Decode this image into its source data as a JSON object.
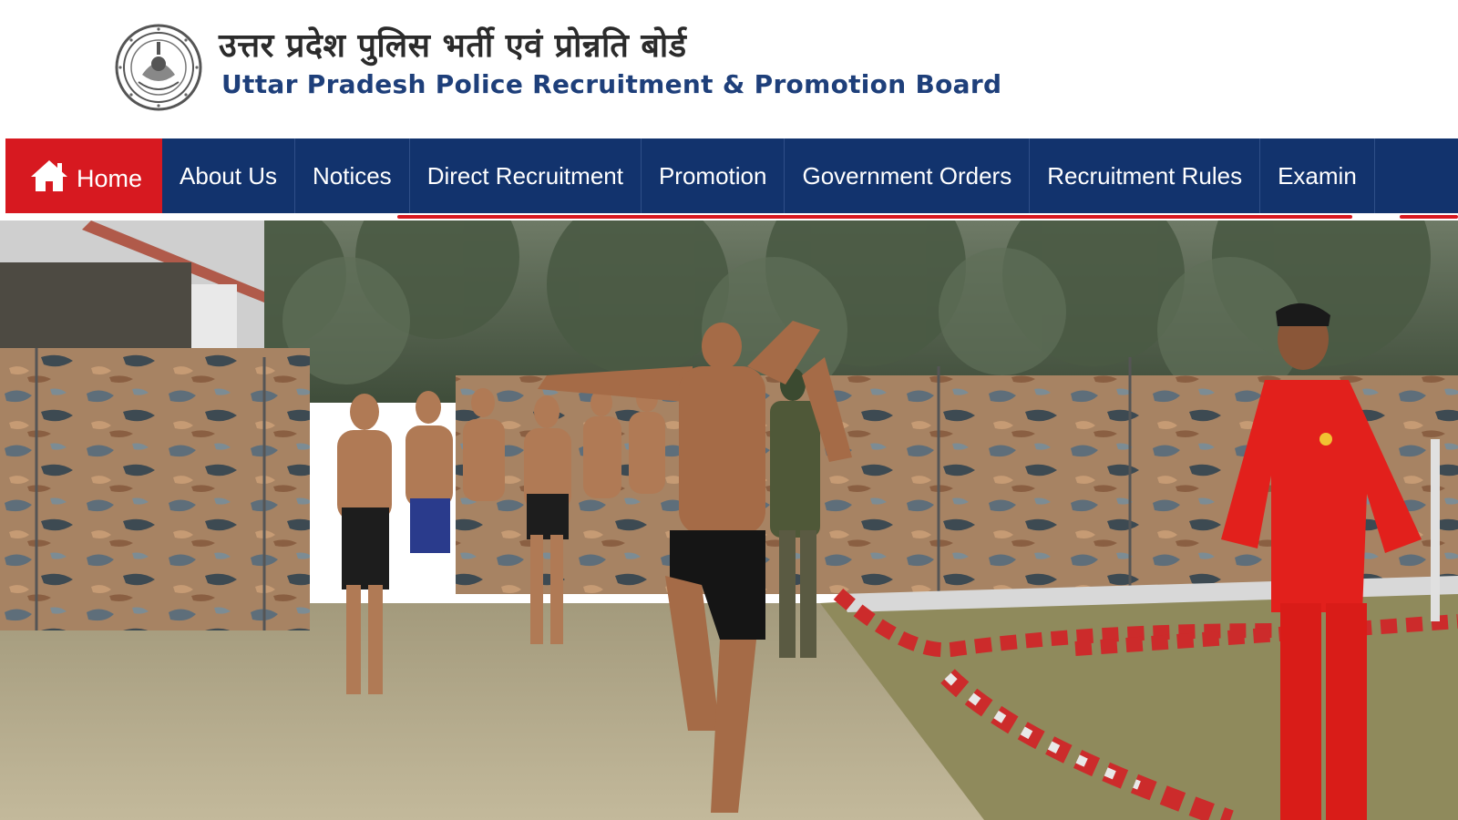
{
  "header": {
    "title_hindi": "उत्तर प्रदेश पुलिस भर्ती एवं प्रोन्नति बोर्ड",
    "title_english": "Uttar Pradesh Police Recruitment & Promotion Board",
    "emblem_icon": "up-police-emblem-icon"
  },
  "nav": {
    "items": [
      {
        "label": "Home",
        "icon": "home-icon",
        "active": true
      },
      {
        "label": "About Us"
      },
      {
        "label": "Notices"
      },
      {
        "label": "Direct Recruitment"
      },
      {
        "label": "Promotion"
      },
      {
        "label": "Government Orders"
      },
      {
        "label": "Recruitment Rules"
      },
      {
        "label": "Examin"
      }
    ]
  },
  "colors": {
    "nav_background": "#12336d",
    "active_tab": "#d71920",
    "title_blue": "#1e3f7a"
  }
}
